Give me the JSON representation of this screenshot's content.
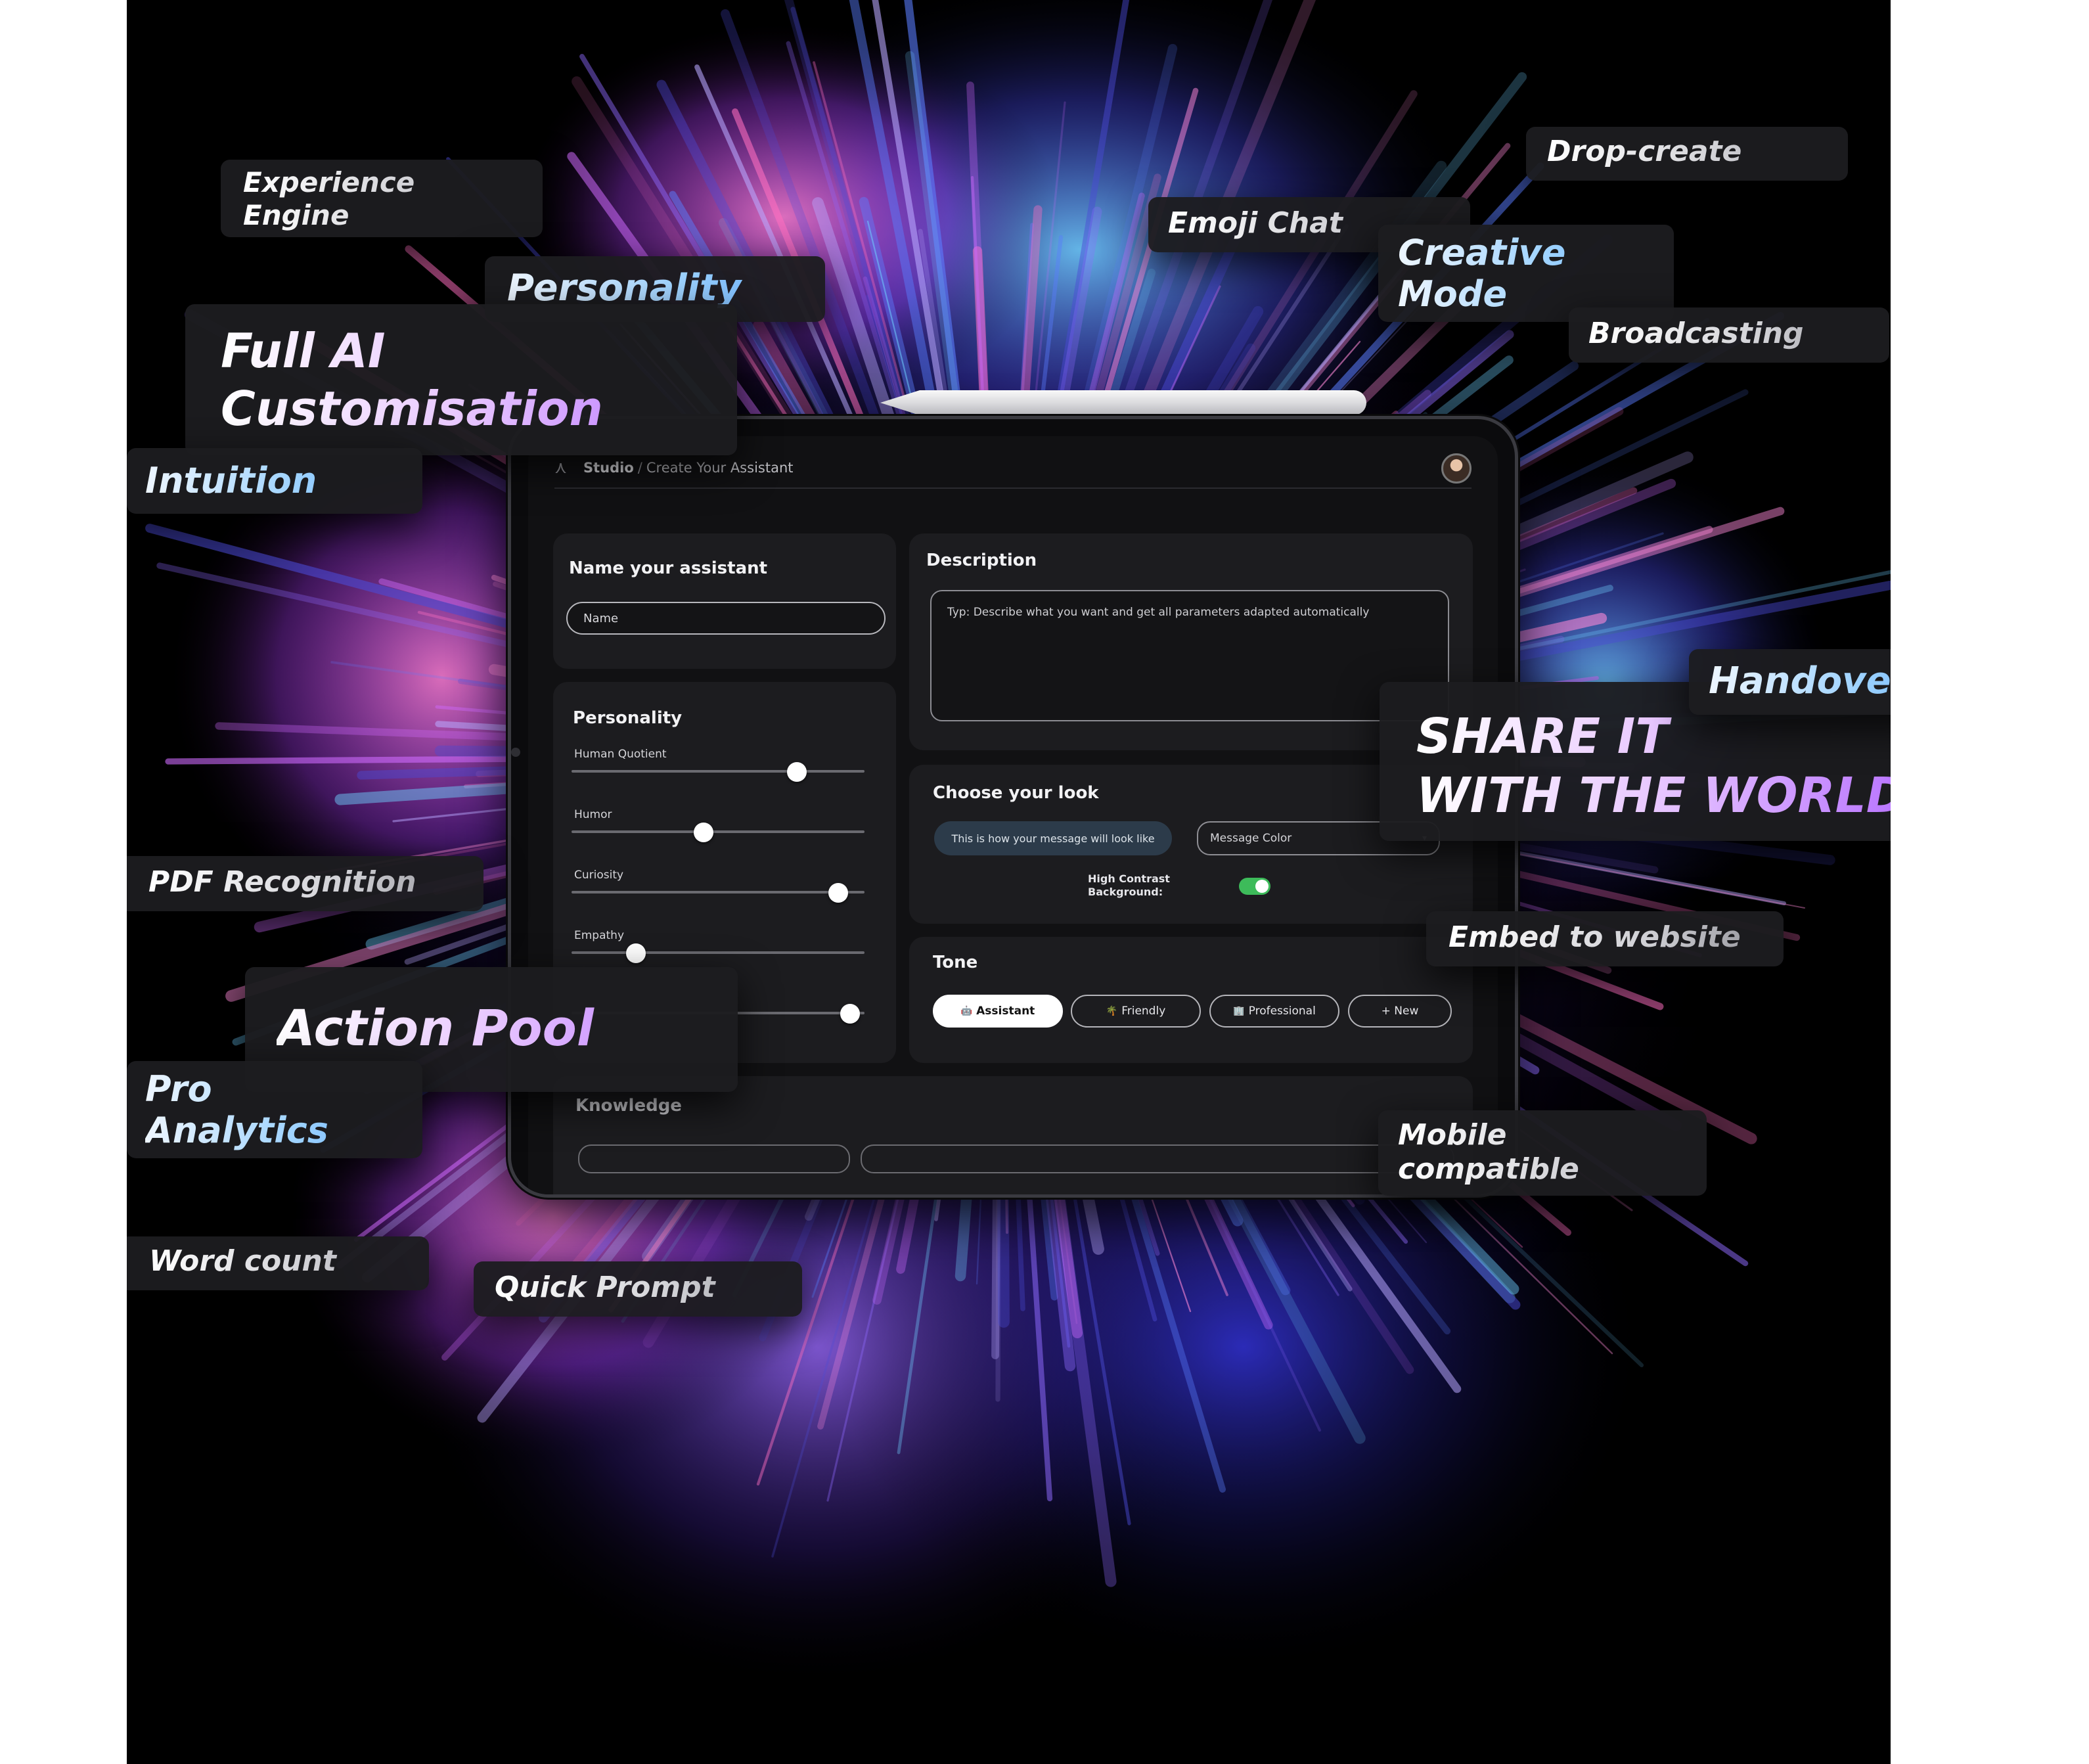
{
  "tablet": {
    "breadcrumb_root": "Studio",
    "breadcrumb_separator": "/",
    "breadcrumb_page": "Create Your Assistant",
    "name_card": {
      "title": "Name your assistant",
      "placeholder": "Name"
    },
    "description_card": {
      "title": "Description",
      "placeholder": "Typ: Describe what you want and get all parameters adapted automatically"
    },
    "personality_card": {
      "title": "Personality",
      "sliders": [
        {
          "label": "Human Quotient",
          "value": 0.77
        },
        {
          "label": "Humor",
          "value": 0.45
        },
        {
          "label": "Curiosity",
          "value": 0.91
        },
        {
          "label": "Empathy",
          "value": 0.22
        },
        {
          "label": "",
          "value": 0.95
        }
      ]
    },
    "look_card": {
      "title": "Choose your look",
      "preview_text": "This is how your message will look like",
      "color_select": "Message Color",
      "contrast_label": "High Contrast Background:",
      "contrast_on": true
    },
    "tone_card": {
      "title": "Tone",
      "options": [
        {
          "emoji": "🤖",
          "label": "Assistant",
          "active": true
        },
        {
          "emoji": "🌴",
          "label": "Friendly",
          "active": false
        },
        {
          "emoji": "🏢",
          "label": "Professional",
          "active": false
        },
        {
          "emoji": "",
          "label": "+ New",
          "active": false
        }
      ]
    },
    "knowledge_card": {
      "title": "Knowledge"
    }
  },
  "labels": {
    "experience_engine": [
      "Experience",
      "Engine"
    ],
    "personality": "Personality",
    "full_ai": [
      "Full AI",
      "Customisation"
    ],
    "intuition": "Intuition",
    "emoji_chat": "Emoji Chat",
    "drop_create": "Drop-create",
    "creative_mode": [
      "Creative",
      "Mode"
    ],
    "broadcasting": "Broadcasting",
    "handover": "Handover",
    "share": [
      "SHARE IT",
      "WITH THE WORLD"
    ],
    "pdf": "PDF Recognition",
    "action_pool": "Action Pool",
    "pro_analytics": [
      "Pro",
      "Analytics"
    ],
    "embed": "Embed to website",
    "mobile": [
      "Mobile",
      "compatible"
    ],
    "word_count": "Word count",
    "quick_prompt": "Quick Prompt"
  }
}
